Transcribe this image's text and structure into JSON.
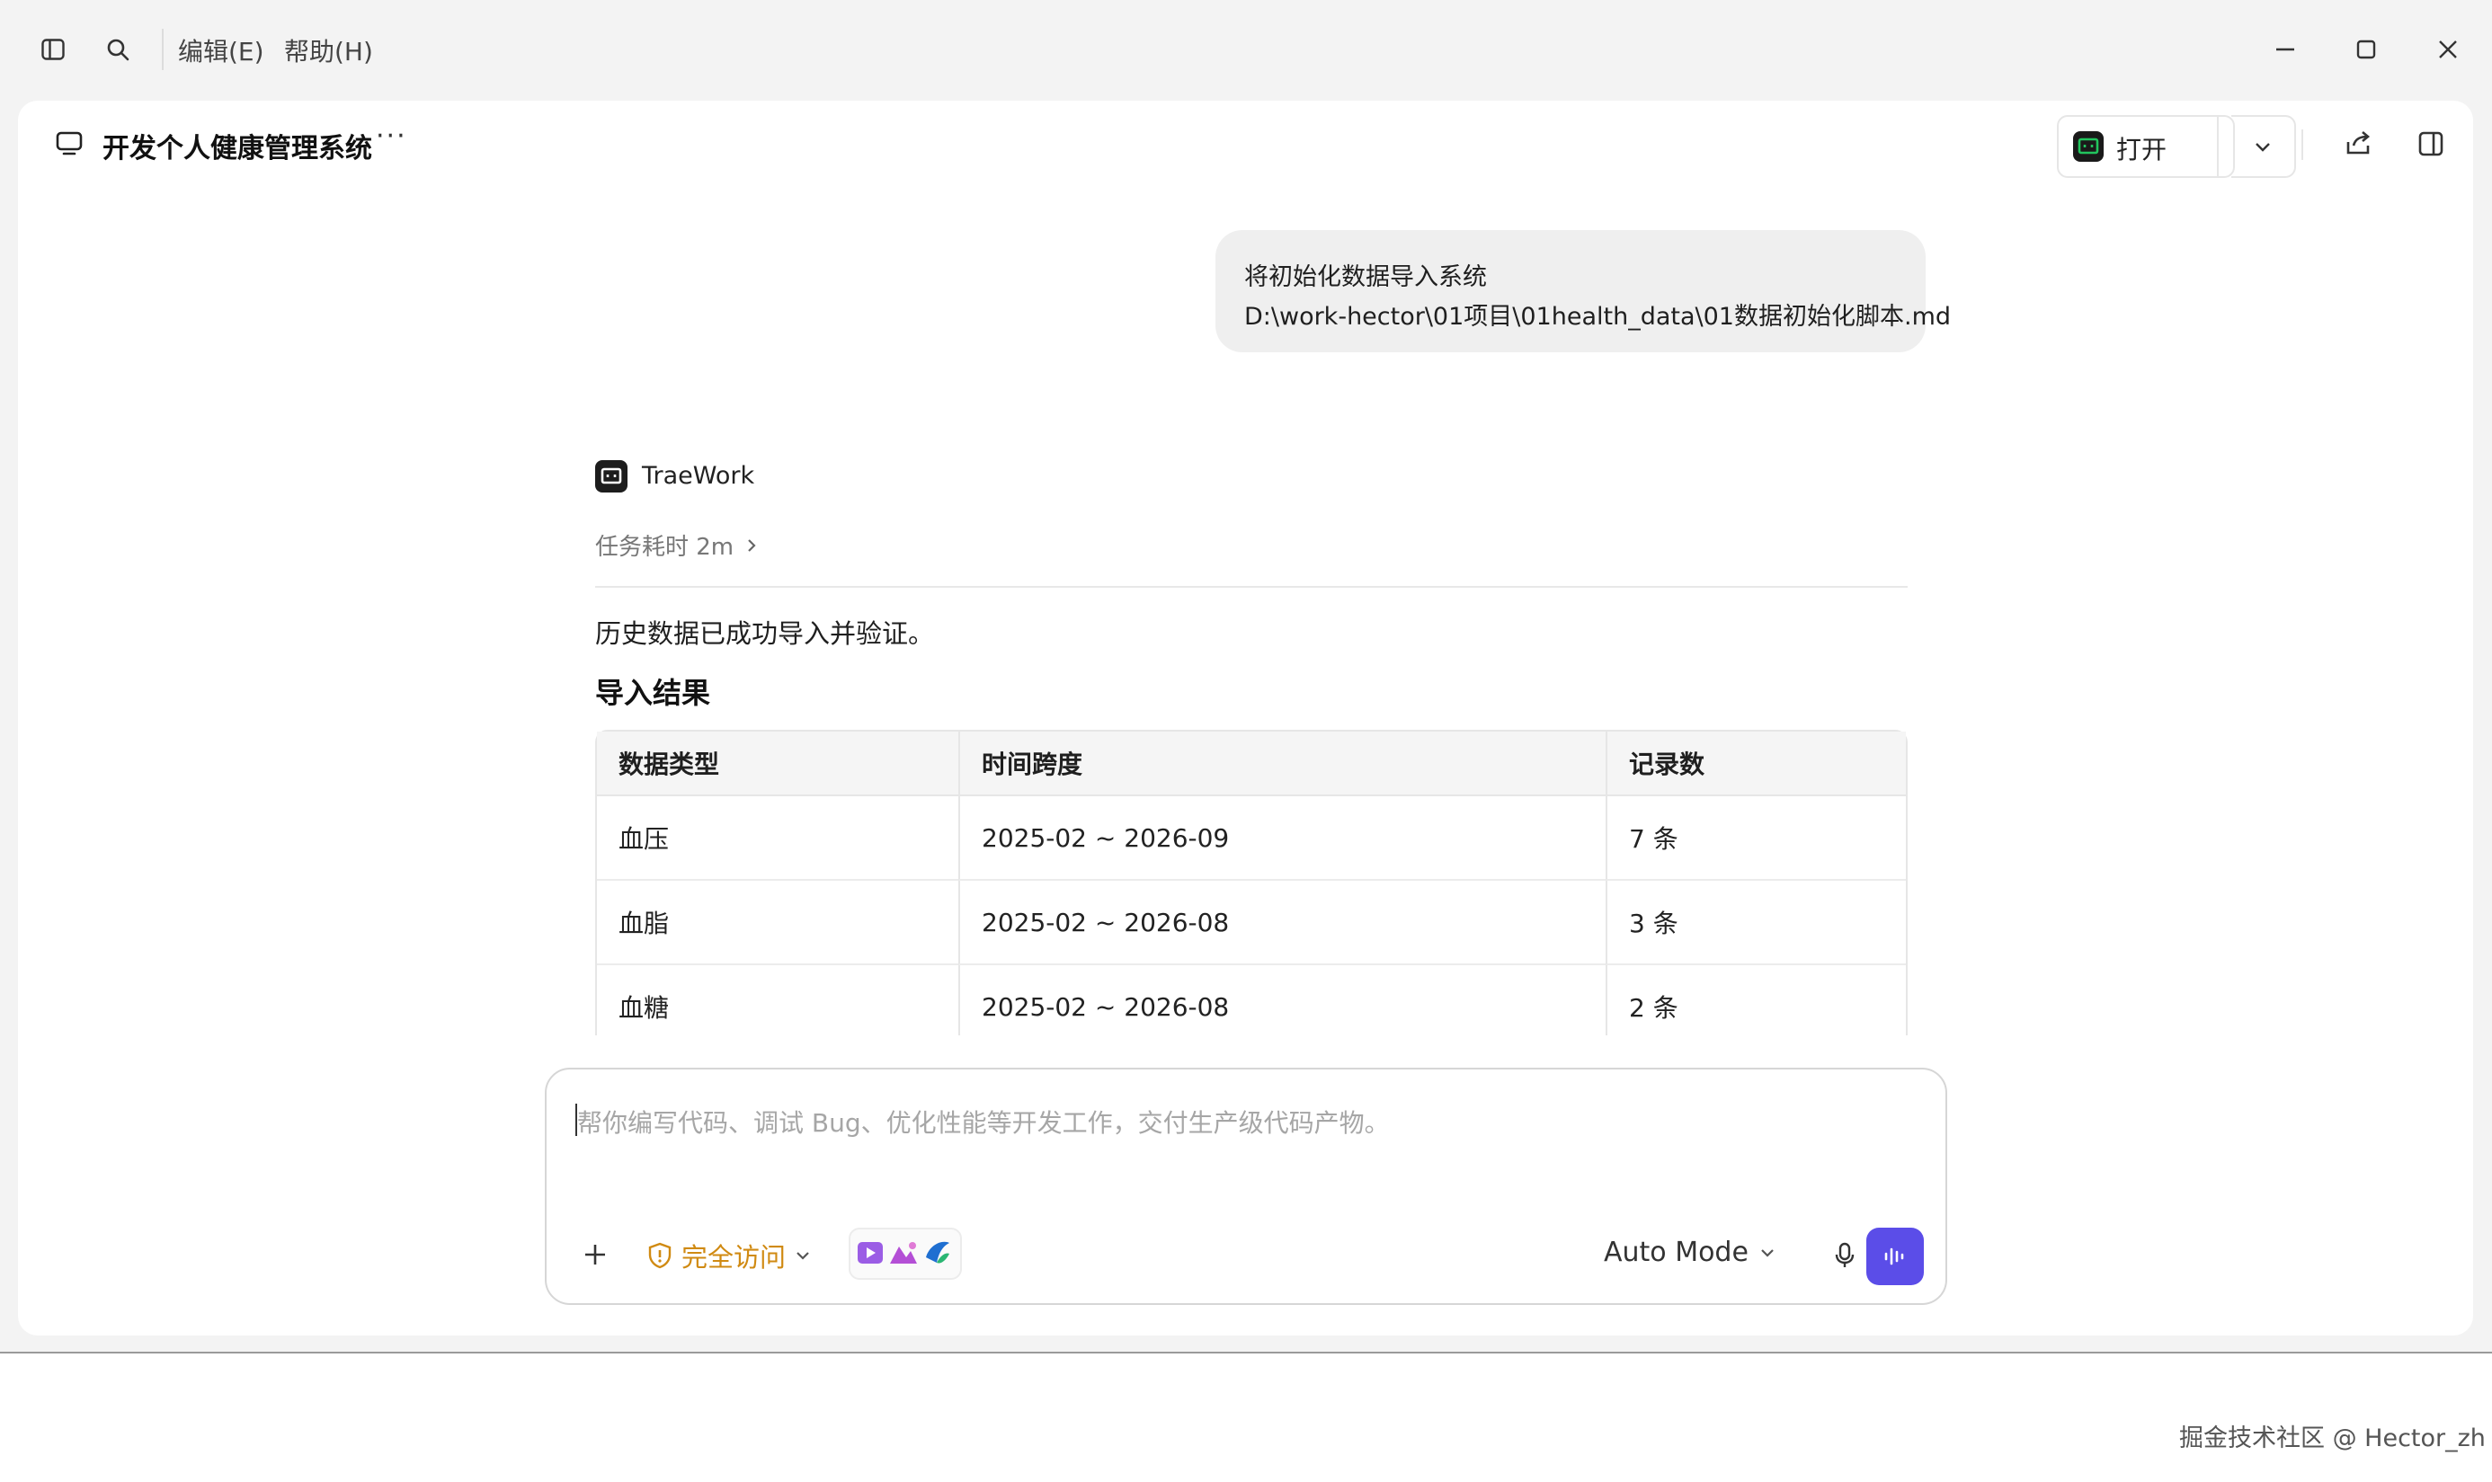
{
  "menu": {
    "edit": "编辑(E)",
    "help": "帮助(H)"
  },
  "header": {
    "title": "开发个人健康管理系统",
    "more": "···",
    "open_label": "打开"
  },
  "user_message": {
    "line1": "将初始化数据导入系统",
    "line2": "D:\\work-hector\\01项目\\01health_data\\01数据初始化脚本.md"
  },
  "assistant": {
    "name": "TraeWork",
    "task_time": "任务耗时 2m",
    "summary": "历史数据已成功导入并验证。",
    "section_title": "导入结果",
    "table": {
      "headers": [
        "数据类型",
        "时间跨度",
        "记录数"
      ],
      "rows": [
        [
          "血压",
          "2025-02 ~ 2026-09",
          "7 条"
        ],
        [
          "血脂",
          "2025-02 ~ 2026-08",
          "3 条"
        ],
        [
          "血糖",
          "2025-02 ~ 2026-08",
          "2 条"
        ]
      ]
    }
  },
  "composer": {
    "placeholder": "帮你编写代码、调试 Bug、优化性能等开发工作，交付生产级代码产物。",
    "access_label": "完全访问",
    "mode_label": "Auto Mode"
  },
  "watermark": "掘金技术社区 @ Hector_zh",
  "colors": {
    "accent": "#5b4de8",
    "access": "#d08a12",
    "logo_green": "#22c55e"
  }
}
